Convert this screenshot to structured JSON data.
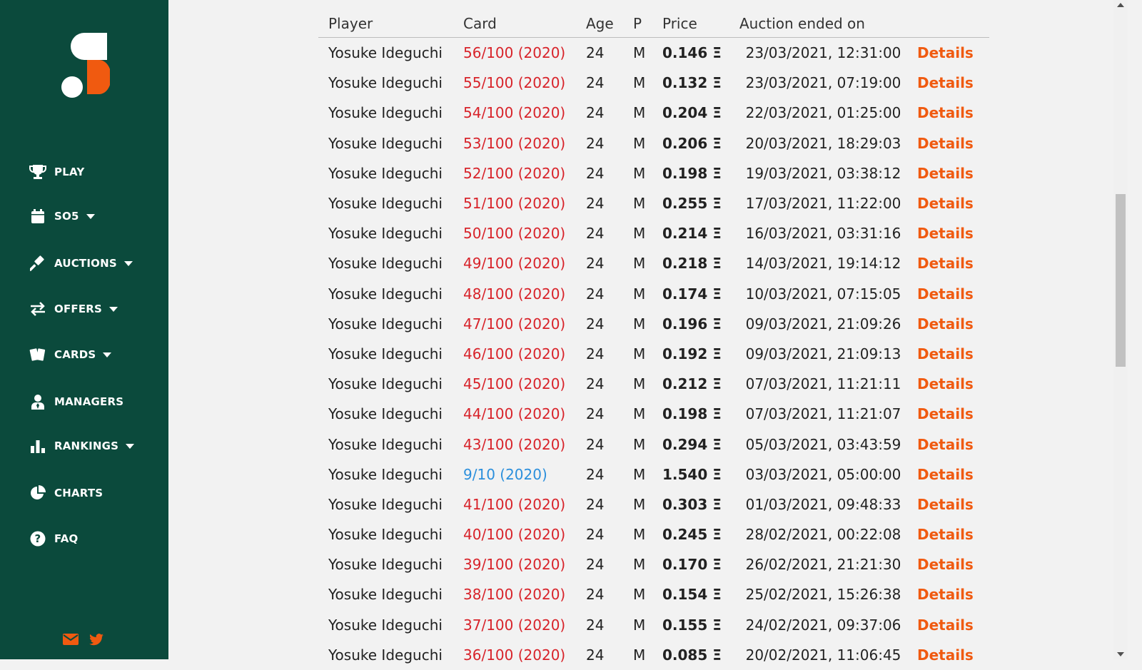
{
  "nav": [
    {
      "label": "PLAY",
      "icon": "trophy-icon",
      "caret": false
    },
    {
      "label": "SO5",
      "icon": "calendar-icon",
      "caret": true
    },
    {
      "label": "AUCTIONS",
      "icon": "gavel-icon",
      "caret": true
    },
    {
      "label": "OFFERS",
      "icon": "swap-arrows-icon",
      "caret": true
    },
    {
      "label": "CARDS",
      "icon": "cards-icon",
      "caret": true
    },
    {
      "label": "MANAGERS",
      "icon": "manager-icon",
      "caret": false
    },
    {
      "label": "RANKINGS",
      "icon": "bar-chart-icon",
      "caret": true
    },
    {
      "label": "CHARTS",
      "icon": "pie-chart-icon",
      "caret": false
    },
    {
      "label": "FAQ",
      "icon": "question-icon",
      "caret": false
    }
  ],
  "colors": {
    "sidebar": "#0b4a3c",
    "accent": "#f05a10",
    "card_red": "#d8232a",
    "card_blue": "#2b8fdc",
    "background": "#f2f2f2"
  },
  "table": {
    "headers": [
      "Player",
      "Card",
      "Age",
      "P",
      "Price",
      "Auction ended on",
      ""
    ],
    "rows": [
      {
        "player": "Yosuke Ideguchi",
        "card": "56/100 (2020)",
        "age": "24",
        "pos": "M",
        "price": "0.146 Ξ",
        "date": "23/03/2021, 12:31:00",
        "details": "Details",
        "rarity": "rare"
      },
      {
        "player": "Yosuke Ideguchi",
        "card": "55/100 (2020)",
        "age": "24",
        "pos": "M",
        "price": "0.132 Ξ",
        "date": "23/03/2021, 07:19:00",
        "details": "Details",
        "rarity": "rare"
      },
      {
        "player": "Yosuke Ideguchi",
        "card": "54/100 (2020)",
        "age": "24",
        "pos": "M",
        "price": "0.204 Ξ",
        "date": "22/03/2021, 01:25:00",
        "details": "Details",
        "rarity": "rare"
      },
      {
        "player": "Yosuke Ideguchi",
        "card": "53/100 (2020)",
        "age": "24",
        "pos": "M",
        "price": "0.206 Ξ",
        "date": "20/03/2021, 18:29:03",
        "details": "Details",
        "rarity": "rare"
      },
      {
        "player": "Yosuke Ideguchi",
        "card": "52/100 (2020)",
        "age": "24",
        "pos": "M",
        "price": "0.198 Ξ",
        "date": "19/03/2021, 03:38:12",
        "details": "Details",
        "rarity": "rare"
      },
      {
        "player": "Yosuke Ideguchi",
        "card": "51/100 (2020)",
        "age": "24",
        "pos": "M",
        "price": "0.255 Ξ",
        "date": "17/03/2021, 11:22:00",
        "details": "Details",
        "rarity": "rare"
      },
      {
        "player": "Yosuke Ideguchi",
        "card": "50/100 (2020)",
        "age": "24",
        "pos": "M",
        "price": "0.214 Ξ",
        "date": "16/03/2021, 03:31:16",
        "details": "Details",
        "rarity": "rare"
      },
      {
        "player": "Yosuke Ideguchi",
        "card": "49/100 (2020)",
        "age": "24",
        "pos": "M",
        "price": "0.218 Ξ",
        "date": "14/03/2021, 19:14:12",
        "details": "Details",
        "rarity": "rare"
      },
      {
        "player": "Yosuke Ideguchi",
        "card": "48/100 (2020)",
        "age": "24",
        "pos": "M",
        "price": "0.174 Ξ",
        "date": "10/03/2021, 07:15:05",
        "details": "Details",
        "rarity": "rare"
      },
      {
        "player": "Yosuke Ideguchi",
        "card": "47/100 (2020)",
        "age": "24",
        "pos": "M",
        "price": "0.196 Ξ",
        "date": "09/03/2021, 21:09:26",
        "details": "Details",
        "rarity": "rare"
      },
      {
        "player": "Yosuke Ideguchi",
        "card": "46/100 (2020)",
        "age": "24",
        "pos": "M",
        "price": "0.192 Ξ",
        "date": "09/03/2021, 21:09:13",
        "details": "Details",
        "rarity": "rare"
      },
      {
        "player": "Yosuke Ideguchi",
        "card": "45/100 (2020)",
        "age": "24",
        "pos": "M",
        "price": "0.212 Ξ",
        "date": "07/03/2021, 11:21:11",
        "details": "Details",
        "rarity": "rare"
      },
      {
        "player": "Yosuke Ideguchi",
        "card": "44/100 (2020)",
        "age": "24",
        "pos": "M",
        "price": "0.198 Ξ",
        "date": "07/03/2021, 11:21:07",
        "details": "Details",
        "rarity": "rare"
      },
      {
        "player": "Yosuke Ideguchi",
        "card": "43/100 (2020)",
        "age": "24",
        "pos": "M",
        "price": "0.294 Ξ",
        "date": "05/03/2021, 03:43:59",
        "details": "Details",
        "rarity": "rare"
      },
      {
        "player": "Yosuke Ideguchi",
        "card": "9/10 (2020)",
        "age": "24",
        "pos": "M",
        "price": "1.540 Ξ",
        "date": "03/03/2021, 05:00:00",
        "details": "Details",
        "rarity": "super-rare"
      },
      {
        "player": "Yosuke Ideguchi",
        "card": "41/100 (2020)",
        "age": "24",
        "pos": "M",
        "price": "0.303 Ξ",
        "date": "01/03/2021, 09:48:33",
        "details": "Details",
        "rarity": "rare"
      },
      {
        "player": "Yosuke Ideguchi",
        "card": "40/100 (2020)",
        "age": "24",
        "pos": "M",
        "price": "0.245 Ξ",
        "date": "28/02/2021, 00:22:08",
        "details": "Details",
        "rarity": "rare"
      },
      {
        "player": "Yosuke Ideguchi",
        "card": "39/100 (2020)",
        "age": "24",
        "pos": "M",
        "price": "0.170 Ξ",
        "date": "26/02/2021, 21:21:30",
        "details": "Details",
        "rarity": "rare"
      },
      {
        "player": "Yosuke Ideguchi",
        "card": "38/100 (2020)",
        "age": "24",
        "pos": "M",
        "price": "0.154 Ξ",
        "date": "25/02/2021, 15:26:38",
        "details": "Details",
        "rarity": "rare"
      },
      {
        "player": "Yosuke Ideguchi",
        "card": "37/100 (2020)",
        "age": "24",
        "pos": "M",
        "price": "0.155 Ξ",
        "date": "24/02/2021, 09:37:06",
        "details": "Details",
        "rarity": "rare"
      },
      {
        "player": "Yosuke Ideguchi",
        "card": "36/100 (2020)",
        "age": "24",
        "pos": "M",
        "price": "0.085 Ξ",
        "date": "20/02/2021, 11:06:45",
        "details": "Details",
        "rarity": "rare"
      }
    ]
  }
}
